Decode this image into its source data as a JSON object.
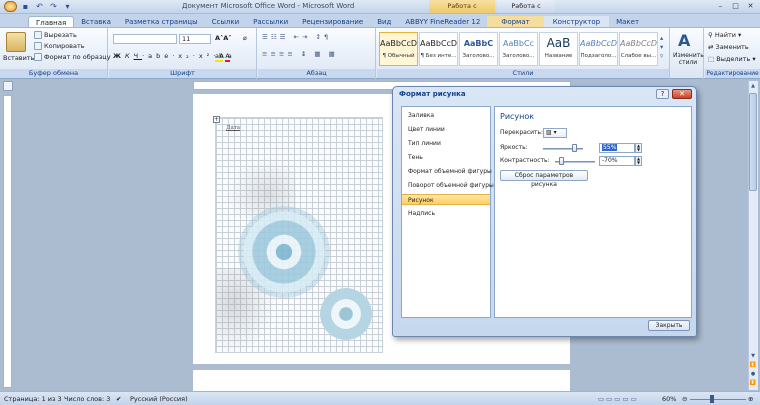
{
  "title_bar": {
    "doc_title": "Документ Microsoft Office Word - Microsoft Word",
    "ctx_picture": "Работа с рисунками",
    "ctx_table": "Работа с таблицами"
  },
  "tabs": [
    "Главная",
    "Вставка",
    "Разметка страницы",
    "Ссылки",
    "Рассылки",
    "Рецензирование",
    "Вид",
    "ABBYY FineReader 12",
    "Формат",
    "Конструктор",
    "Макет"
  ],
  "ribbon": {
    "paste_label": "Вставить",
    "cut": "Вырезать",
    "copy": "Копировать",
    "format_painter": "Формат по образцу",
    "clipboard_group": "Буфер обмена",
    "font_size": "11",
    "font_group": "Шрифт",
    "paragraph_group": "Абзац",
    "styles_group": "Стили",
    "styles": [
      {
        "sample": "AaBbCcDc",
        "name": "¶ Обычный"
      },
      {
        "sample": "AaBbCcDc",
        "name": "¶ Без инте..."
      },
      {
        "sample": "AaBbC",
        "name": "Заголово..."
      },
      {
        "sample": "AaBbCc",
        "name": "Заголово..."
      },
      {
        "sample": "AaB",
        "name": "Название"
      },
      {
        "sample": "AaBbCcDc",
        "name": "Подзаголо..."
      },
      {
        "sample": "AaBbCcDc",
        "name": "Слабое вы..."
      }
    ],
    "change_styles": "Изменить стили",
    "find": "Найти",
    "replace": "Заменить",
    "select": "Выделить",
    "editing_group": "Редактирование"
  },
  "document": {
    "date_label": "Дата"
  },
  "dialog": {
    "title": "Формат рисунка",
    "nav_items": [
      "Заливка",
      "Цвет линии",
      "Тип линии",
      "Тень",
      "Формат объемной фигуры",
      "Поворот объемной фигуры",
      "Рисунок",
      "Надпись"
    ],
    "selected_nav_index": 6,
    "panel_heading": "Рисунок",
    "recolor_label": "Перекрасить:",
    "brightness_label": "Яркость:",
    "brightness_value": "55%",
    "brightness_level": 0.775,
    "contrast_label": "Контрастность:",
    "contrast_value": "-70%",
    "contrast_level": 0.15,
    "reset_button": "Сброс параметров рисунка",
    "close_button": "Закрыть"
  },
  "status_bar": {
    "page": "Страница: 1 из 3",
    "words": "Число слов: 3",
    "language": "Русский (Россия)",
    "zoom": "60%"
  }
}
